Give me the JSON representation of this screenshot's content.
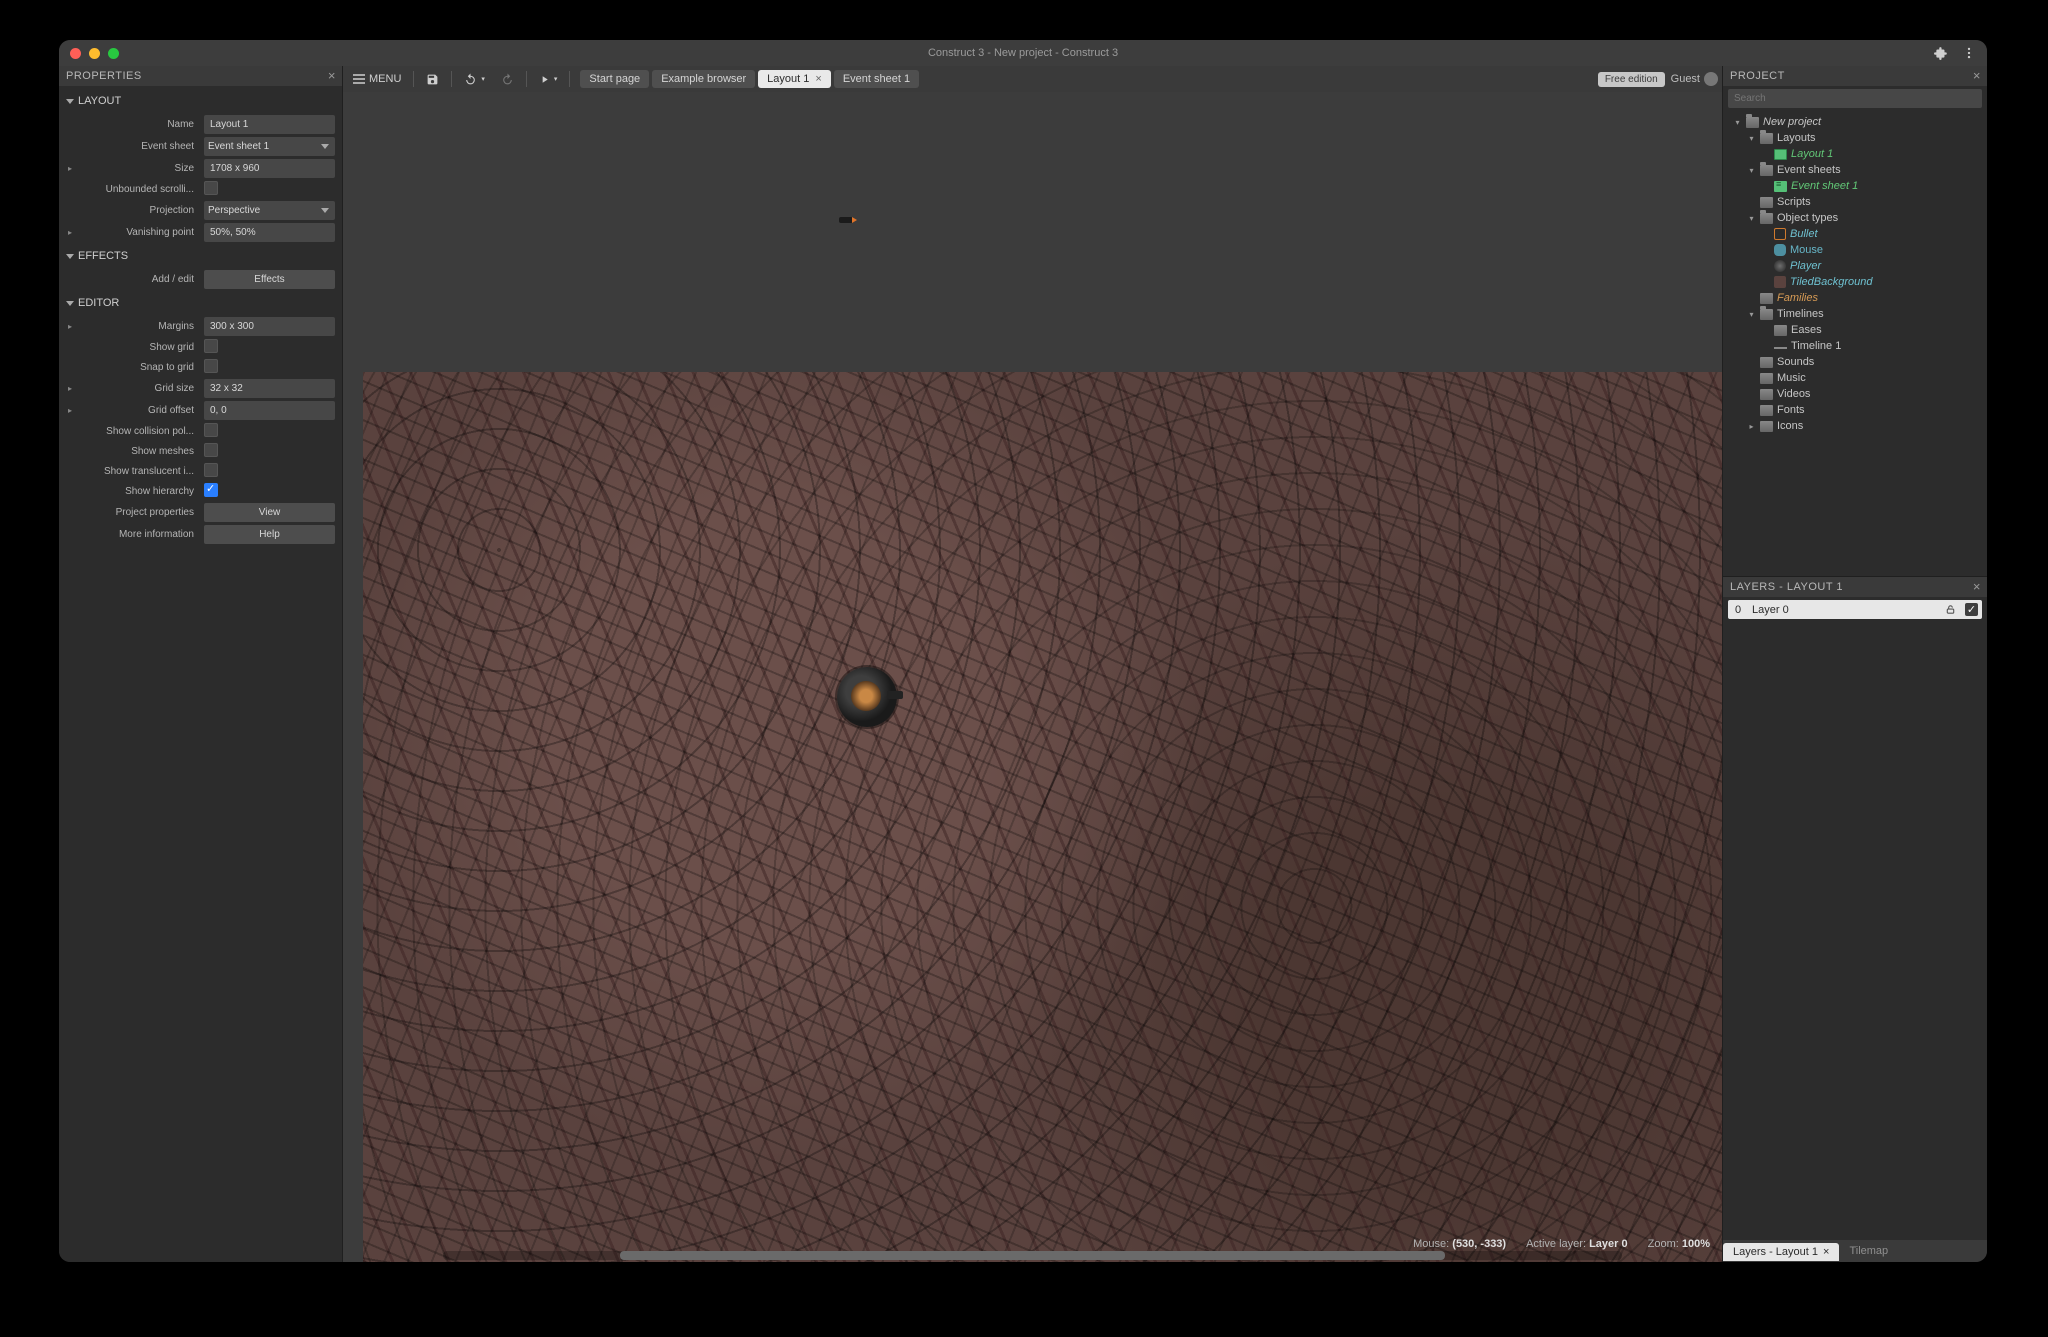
{
  "titlebar": {
    "title": "Construct 3 - New project - Construct 3"
  },
  "toolbar": {
    "menu_label": "MENU",
    "free_edition": "Free edition",
    "guest": "Guest",
    "tabs": [
      {
        "label": "Start page",
        "active": false,
        "closable": false
      },
      {
        "label": "Example browser",
        "active": false,
        "closable": false
      },
      {
        "label": "Layout 1",
        "active": true,
        "closable": true
      },
      {
        "label": "Event sheet 1",
        "active": false,
        "closable": false
      }
    ]
  },
  "properties": {
    "panel_title": "PROPERTIES",
    "groups": {
      "layout": "LAYOUT",
      "effects": "EFFECTS",
      "editor": "EDITOR"
    },
    "layout": {
      "name_label": "Name",
      "name": "Layout 1",
      "eventsheet_label": "Event sheet",
      "eventsheet": "Event sheet 1",
      "size_label": "Size",
      "size": "1708 x 960",
      "unbounded_label": "Unbounded scrolli...",
      "unbounded": false,
      "projection_label": "Projection",
      "projection": "Perspective",
      "vp_label": "Vanishing point",
      "vp": "50%, 50%"
    },
    "effects": {
      "addedit_label": "Add / edit",
      "effects_btn": "Effects"
    },
    "editor": {
      "margins_label": "Margins",
      "margins": "300 x 300",
      "showgrid_label": "Show grid",
      "showgrid": false,
      "snap_label": "Snap to grid",
      "snap": false,
      "gridsize_label": "Grid size",
      "gridsize": "32 x 32",
      "gridoffset_label": "Grid offset",
      "gridoffset": "0, 0",
      "collision_label": "Show collision pol...",
      "collision": false,
      "meshes_label": "Show meshes",
      "meshes": false,
      "translucent_label": "Show translucent i...",
      "translucent": false,
      "hierarchy_label": "Show hierarchy",
      "hierarchy": true,
      "projprops_label": "Project properties",
      "view_btn": "View",
      "moreinfo_label": "More information",
      "help_btn": "Help"
    }
  },
  "status": {
    "mouse_label": "Mouse:",
    "mouse": "(530, -333)",
    "layer_label": "Active layer:",
    "layer": "Layer 0",
    "zoom_label": "Zoom:",
    "zoom": "100%"
  },
  "project": {
    "panel_title": "PROJECT",
    "search_placeholder": "Search",
    "tree": {
      "root": "New project",
      "layouts": "Layouts",
      "layout1": "Layout 1",
      "eventsheets": "Event sheets",
      "es1": "Event sheet 1",
      "scripts": "Scripts",
      "objecttypes": "Object types",
      "bullet": "Bullet",
      "mouse": "Mouse",
      "player": "Player",
      "tiled": "TiledBackground",
      "families": "Families",
      "timelines": "Timelines",
      "eases": "Eases",
      "timeline1": "Timeline 1",
      "sounds": "Sounds",
      "music": "Music",
      "videos": "Videos",
      "fonts": "Fonts",
      "icons": "Icons"
    }
  },
  "layers": {
    "panel_title": "LAYERS - LAYOUT 1",
    "rows": [
      {
        "index": "0",
        "name": "Layer 0"
      }
    ],
    "tabs": {
      "active": "Layers - Layout 1",
      "other": "Tilemap"
    }
  }
}
